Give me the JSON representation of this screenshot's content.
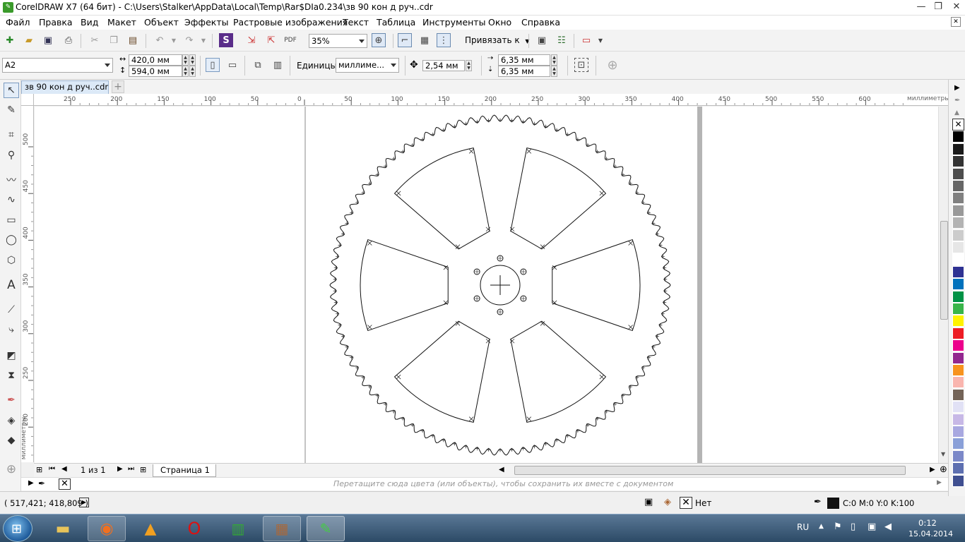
{
  "window": {
    "title": "CorelDRAW X7 (64 бит) - C:\\Users\\Stalker\\AppData\\Local\\Temp\\Rar$DIa0.234\\зв 90 кон д руч..cdr"
  },
  "menu": [
    "Файл",
    "Правка",
    "Вид",
    "Макет",
    "Объект",
    "Эффекты",
    "Растровые изображения",
    "Текст",
    "Таблица",
    "Инструменты",
    "Окно",
    "Справка"
  ],
  "toolbar": {
    "zoom": "35%",
    "snap_label": "Привязать к"
  },
  "propbar": {
    "paper_size": "A2",
    "width": "420,0 мм",
    "height": "594,0 мм",
    "units_label": "Единицы:",
    "units_value": "миллиме...",
    "nudge": "2,54 мм",
    "dup_x": "6,35 мм",
    "dup_y": "6,35 мм"
  },
  "document": {
    "tab": "зв 90 кон д руч..cdr"
  },
  "rulers": {
    "h_ticks": [
      "250",
      "200",
      "150",
      "100",
      "50",
      "0",
      "50",
      "100",
      "150",
      "200",
      "250",
      "300",
      "350",
      "400",
      "450",
      "500",
      "550",
      "600"
    ],
    "h_unit": "миллиметры",
    "v_ticks": [
      "500",
      "450",
      "400",
      "350",
      "300",
      "250",
      "200"
    ],
    "v_unit": "миллиметры"
  },
  "pagenav": {
    "counter": "1 из 1",
    "page_tab": "Страница 1"
  },
  "docpalette": {
    "hint": "Перетащите сюда цвета (или объекты), чтобы сохранить их вместе с документом"
  },
  "status": {
    "coords": "( 517,421; 418,809 )",
    "fill_label": "Нет",
    "outline_label": "C:0 M:0 Y:0 K:100"
  },
  "palette_colors": [
    "#ffffff",
    "#000000",
    "#1a1a1a",
    "#333333",
    "#4d4d4d",
    "#666666",
    "#808080",
    "#999999",
    "#b3b3b3",
    "#cccccc",
    "#e6e6e6",
    "#ffffff",
    "#2e3192",
    "#0071bc",
    "#009245",
    "#39b54a",
    "#fff200",
    "#ed1c24",
    "#ec008c",
    "#92278f",
    "#f7931e",
    "#f9b5ae",
    "#736357",
    "#e1e1f5",
    "#c7b8e6",
    "#a8a8e0",
    "#8aa0d8",
    "#7b88c8",
    "#5d6fb0",
    "#3f4f90"
  ],
  "taskbar": {
    "lang": "RU",
    "time": "0:12",
    "date": "15.04.2014"
  }
}
